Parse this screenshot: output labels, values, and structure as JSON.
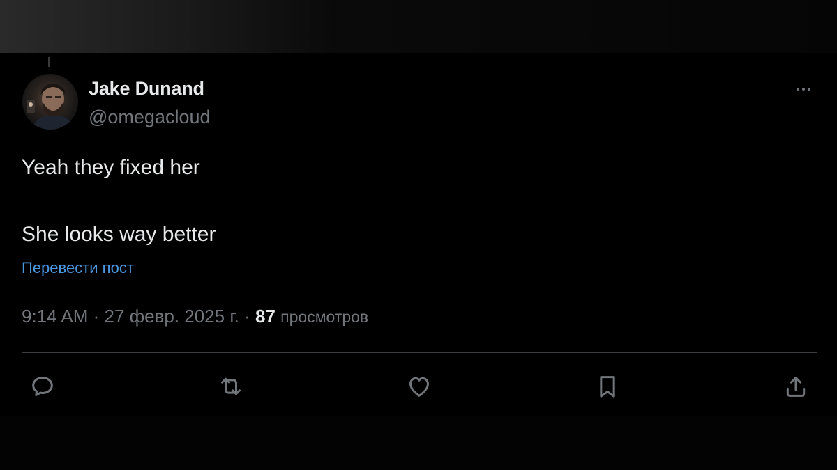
{
  "author": {
    "display_name": "Jake Dunand",
    "handle": "@omegacloud"
  },
  "tweet": {
    "lines": [
      "Yeah they fixed her",
      "She looks way better"
    ],
    "translate_label": "Перевести пост"
  },
  "meta": {
    "time": "9:14 AM",
    "separator": "·",
    "date": "27 февр. 2025 г.",
    "views_count": "87",
    "views_label": "просмотров"
  },
  "actions": [
    {
      "name": "reply",
      "icon": "reply-icon"
    },
    {
      "name": "retweet",
      "icon": "retweet-icon"
    },
    {
      "name": "like",
      "icon": "heart-icon"
    },
    {
      "name": "bookmark",
      "icon": "bookmark-icon"
    },
    {
      "name": "share",
      "icon": "share-icon"
    }
  ],
  "colors": {
    "background": "#000000",
    "text": "#e7e9ea",
    "secondary": "#71767b",
    "link": "#4b97de",
    "divider": "#3a3d40"
  }
}
